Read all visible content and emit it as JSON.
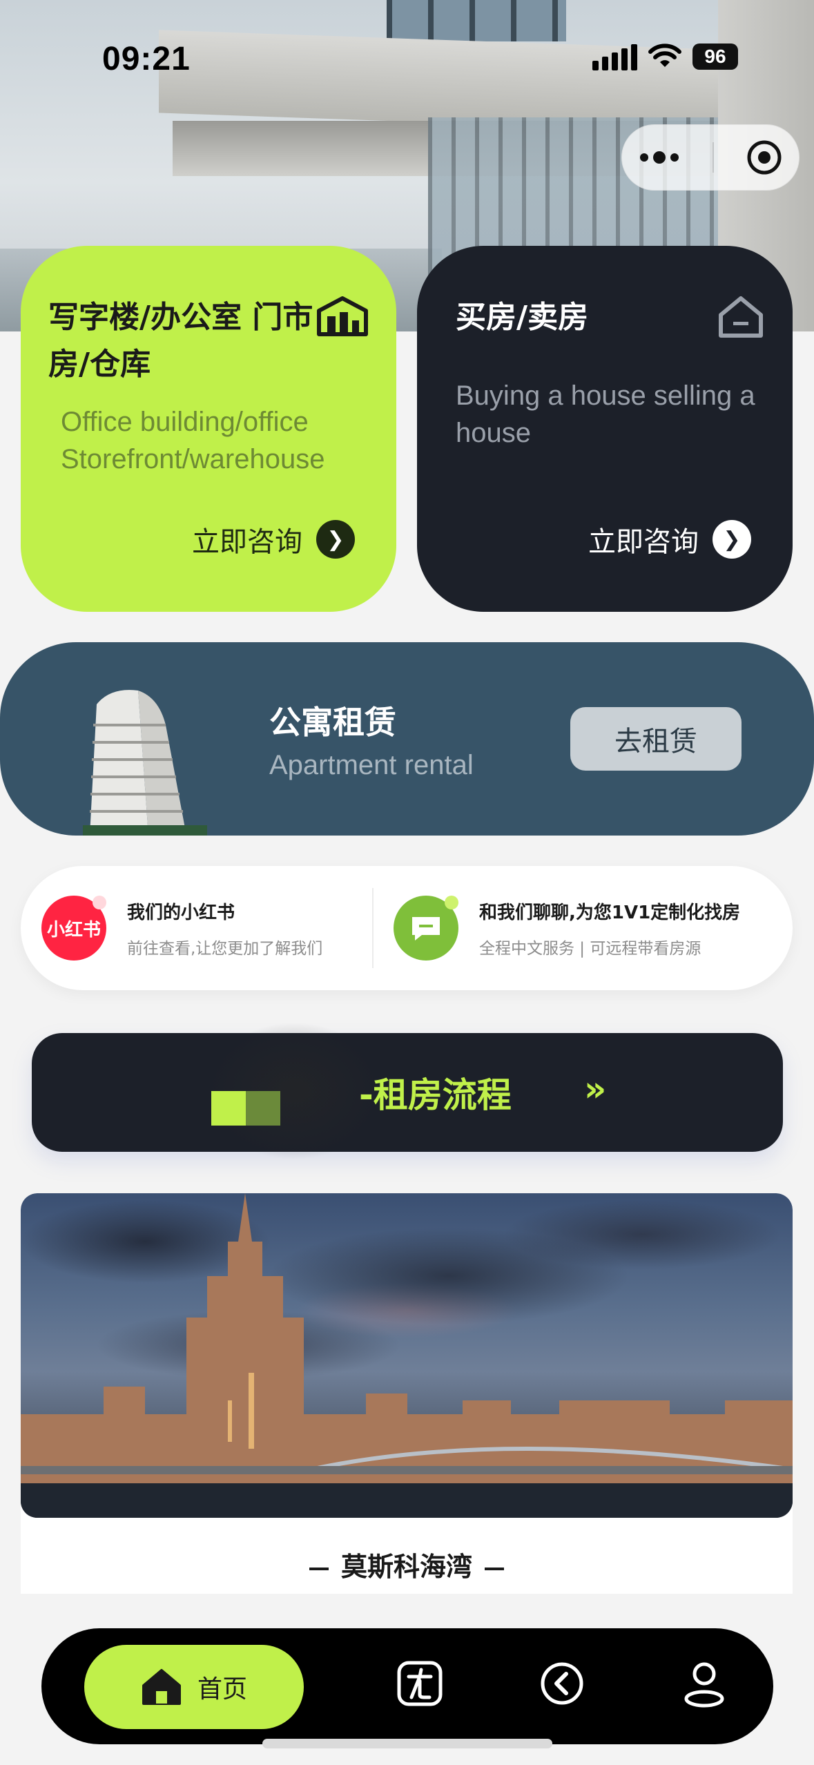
{
  "status_bar": {
    "time": "09:21",
    "battery": "96"
  },
  "cards": [
    {
      "title": "写字楼/办公室 门市房/仓库",
      "subtitle": "Office building/office Storefront/warehouse",
      "cta": "立即咨询",
      "icon": "building-icon"
    },
    {
      "title": "买房/卖房",
      "subtitle": "Buying a house selling a house",
      "cta": "立即咨询",
      "icon": "house-icon"
    }
  ],
  "apartment": {
    "title": "公寓租赁",
    "subtitle": "Apartment rental",
    "button": "去租赁"
  },
  "links": {
    "left": {
      "icon_text": "小红书",
      "title": "我们的小红书",
      "subtitle": "前往查看,让您更加了解我们"
    },
    "right": {
      "title": "和我们聊聊,为您1V1定制化找房",
      "subtitle": "全程中文服务 | 可远程带看房源"
    }
  },
  "process": {
    "label": "-租房流程",
    "arrow": "»"
  },
  "photo": {
    "caption": "莫斯科海湾"
  },
  "tabbar": {
    "home_label": "首页",
    "items": [
      "home-icon",
      "discount-icon",
      "history-icon",
      "profile-icon"
    ]
  },
  "colors": {
    "accent_green": "#c0f04a",
    "dark_card": "#1c2029",
    "apartment_blue": "#375468",
    "xiaohongshu_red": "#ff2442"
  }
}
